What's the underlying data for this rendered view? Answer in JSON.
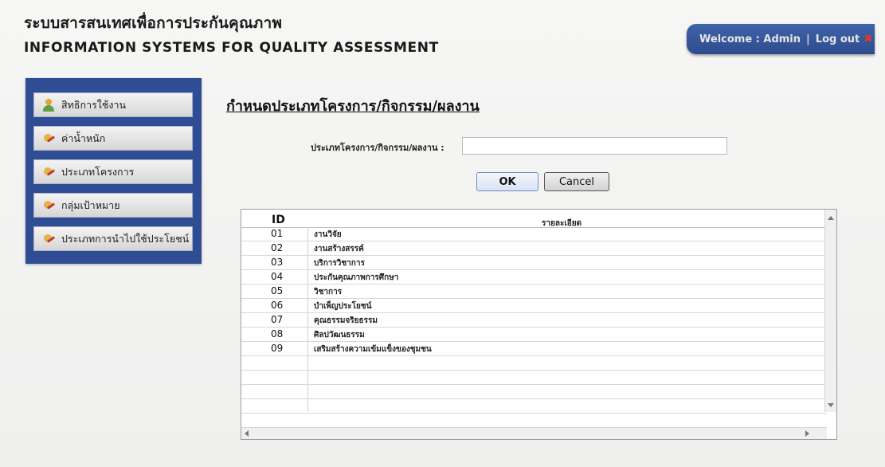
{
  "header": {
    "title_th": "ระบบสารสนเทศเพื่อการประกันคุณภาพ",
    "title_en": "INFORMATION SYSTEMS FOR QUALITY ASSESSMENT"
  },
  "userbar": {
    "welcome": "Welcome : Admin",
    "separator": "|",
    "logout": "Log out",
    "logout_icon": "✖",
    "color": "#2f4d95"
  },
  "sidebar": {
    "items": [
      {
        "label": "สิทธิการใช้งาน",
        "icon": "user-icon"
      },
      {
        "label": "ค่าน้ำหนัก",
        "icon": "edit-icon"
      },
      {
        "label": "ประเภทโครงการ",
        "icon": "edit-icon"
      },
      {
        "label": "กลุ่มเป้าหมาย",
        "icon": "edit-icon"
      },
      {
        "label": "ประเภทการนำไปใช้ประโยชน์",
        "icon": "edit-icon"
      }
    ]
  },
  "main": {
    "title": "กำหนดประเภทโครงการ/กิจกรรม/ผลงาน",
    "form": {
      "label": "ประเภทโครงการ/กิจกรรม/ผลงาน :",
      "value": "",
      "placeholder": ""
    },
    "buttons": {
      "ok": "OK",
      "cancel": "Cancel"
    },
    "table": {
      "columns": [
        "ID",
        "รายละเอียด"
      ],
      "rows": [
        [
          "01",
          "งานวิจัย"
        ],
        [
          "02",
          "งานสร้างสรรค์"
        ],
        [
          "03",
          "บริการวิชาการ"
        ],
        [
          "04",
          "ประกันคุณภาพการศึกษา"
        ],
        [
          "05",
          "วิชาการ"
        ],
        [
          "06",
          "บำเพ็ญประโยชน์"
        ],
        [
          "07",
          "คุณธรรมจริยธรรม"
        ],
        [
          "08",
          "ศิลปวัฒนธรรม"
        ],
        [
          "09",
          "เสริมสร้างความเข้มแข็งของชุมชน"
        ]
      ]
    }
  }
}
